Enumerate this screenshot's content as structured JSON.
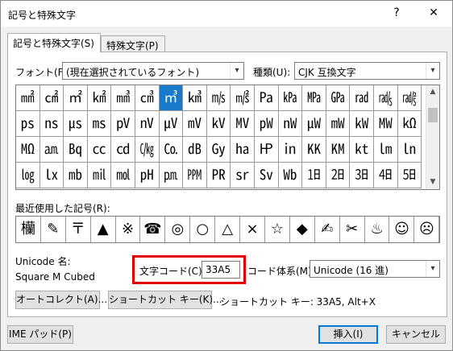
{
  "window": {
    "title": "記号と特殊文字",
    "help": "?",
    "close": "✕"
  },
  "tabs": [
    {
      "label": "記号と特殊文字(S)"
    },
    {
      "label": "特殊文字(P)"
    }
  ],
  "font": {
    "label": "フォント(F):",
    "value": "(現在選択されているフォント)"
  },
  "subset": {
    "label": "種類(U):",
    "value": "CJK 互換文字"
  },
  "symbols": [
    [
      "㎟",
      "㎠",
      "㎡",
      "㎢",
      "㎣",
      "㎤",
      "㎥",
      "㎦",
      "㎧",
      "㎨",
      "㎩",
      "㎪",
      "㎫",
      "㎬",
      "㎭",
      "㎮",
      "㎯"
    ],
    [
      "㎰",
      "㎱",
      "㎲",
      "㎳",
      "㎴",
      "㎵",
      "㎶",
      "㎷",
      "㎸",
      "㎹",
      "㎺",
      "㎻",
      "㎼",
      "㎽",
      "㎾",
      "㎿",
      "㏀"
    ],
    [
      "㏁",
      "㏂",
      "㏃",
      "㏄",
      "㏅",
      "㏆",
      "㏇",
      "㏈",
      "㏉",
      "㏊",
      "㏋",
      "㏌",
      "㏍",
      "㏎",
      "㏏",
      "㏐",
      "㏑"
    ],
    [
      "㏒",
      "㏓",
      "㏔",
      "㏕",
      "㏖",
      "㏗",
      "㏘",
      "㏙",
      "㏚",
      "㏛",
      "㏜",
      "㏝",
      "㏠",
      "㏡",
      "㏢",
      "㏣",
      "㏤"
    ]
  ],
  "recent": {
    "label": "最近使用した記号(R):",
    "items": [
      "欗",
      "✎",
      "〒",
      "▲",
      "※",
      "☎",
      "◎",
      "○",
      "△",
      "×",
      "☆",
      "◆",
      "✍",
      "✂",
      "♨",
      "☺",
      "☹"
    ]
  },
  "unicode_name": {
    "label": "Unicode 名:",
    "value": "Square M Cubed"
  },
  "char_code": {
    "label": "文字コード(C):",
    "value": "33A5"
  },
  "code_system": {
    "label": "コード体系(M):",
    "value": "Unicode (16 進)"
  },
  "buttons": {
    "autocorrect": "オートコレクト(A)...",
    "shortcut_key": "ショートカット キー(K)...",
    "shortcut_text": "ショートカット キー: 33A5, Alt+X",
    "ime_pad": "IME パッド(P)",
    "insert": "挿入(I)",
    "cancel": "キャンセル"
  }
}
